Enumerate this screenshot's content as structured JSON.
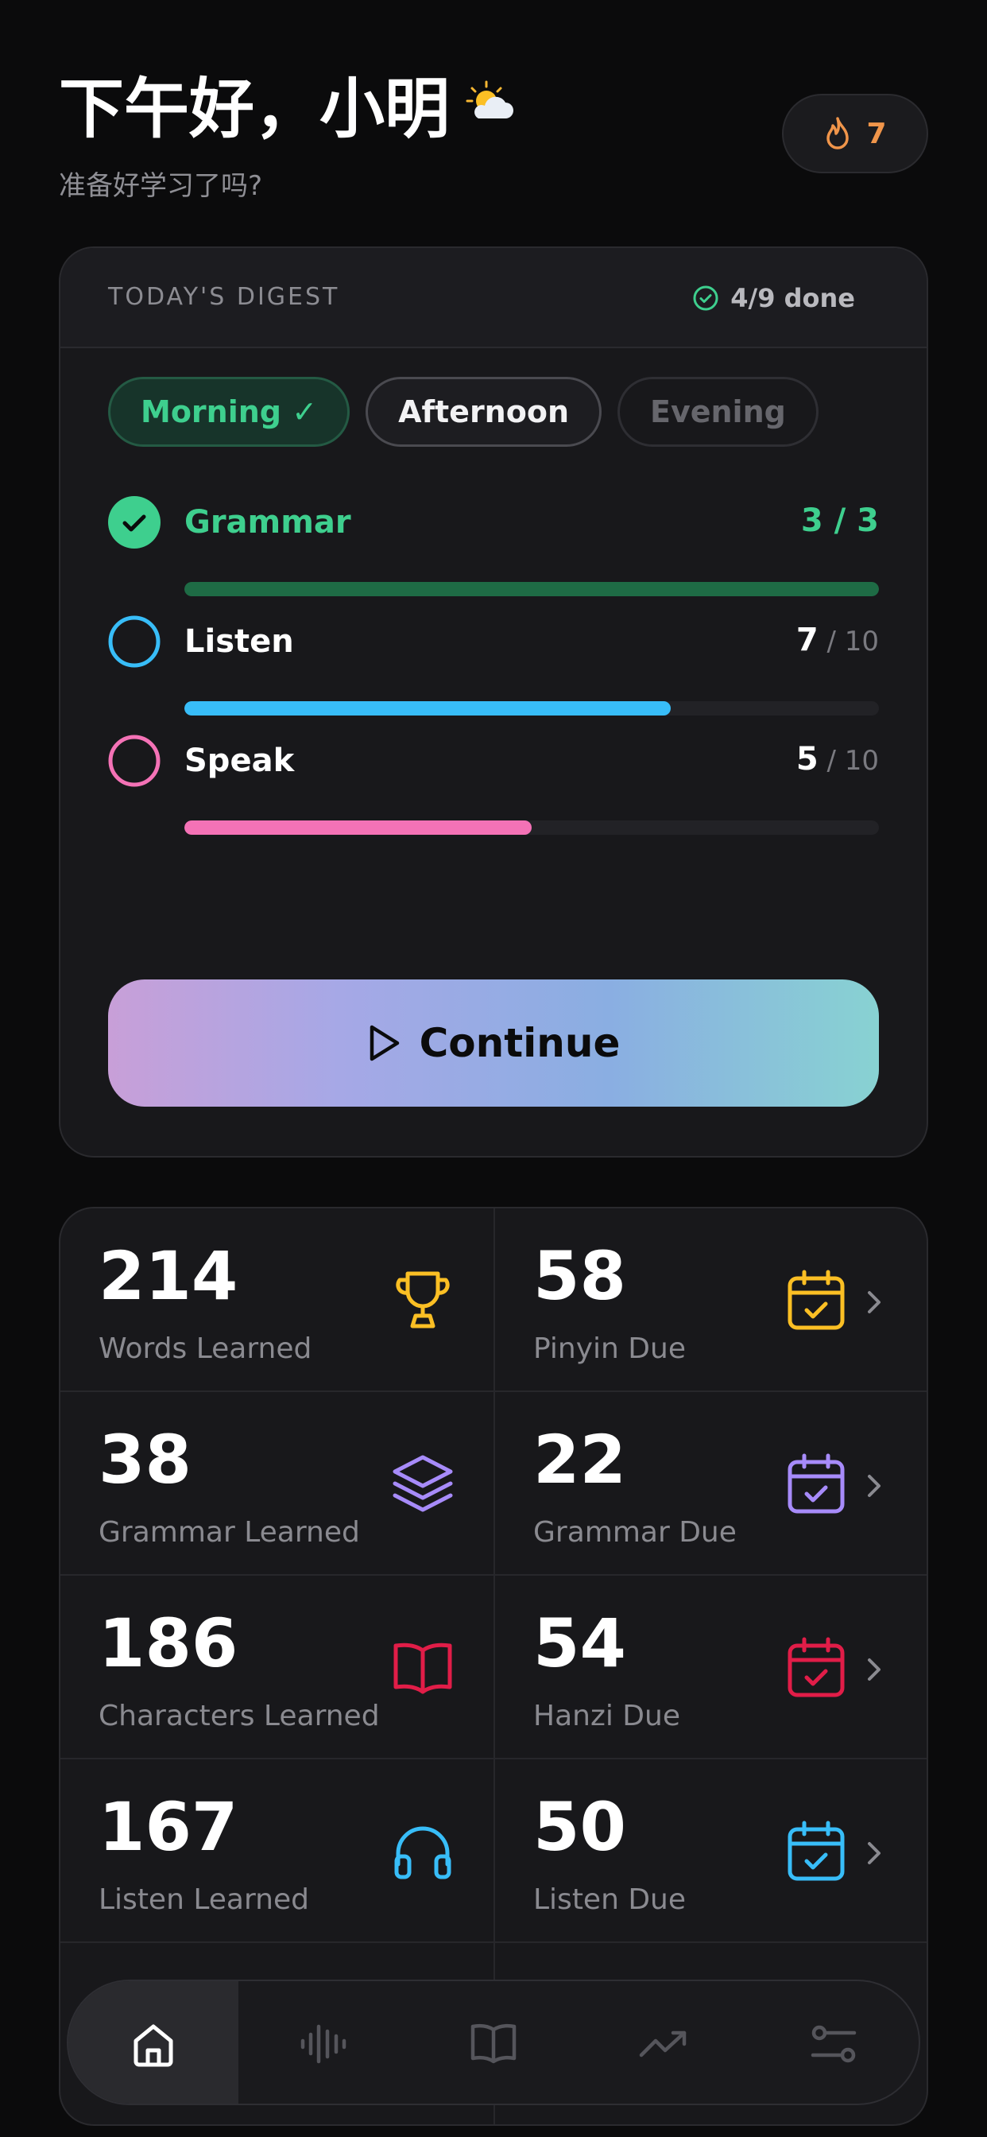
{
  "header": {
    "greeting": "下午好，小明",
    "weather_icon": "sun-behind-cloud-icon",
    "subtitle": "准备好学习了吗?",
    "streak": {
      "icon": "flame-icon",
      "count": "7",
      "color": "#f0954a"
    }
  },
  "digest": {
    "label": "TODAY'S DIGEST",
    "done_text": "4/9 done",
    "tabs": [
      {
        "label": "Morning ✓",
        "state": "completed"
      },
      {
        "label": "Afternoon",
        "state": "selected"
      },
      {
        "label": "Evening",
        "state": "upcoming"
      }
    ],
    "tasks": [
      {
        "name": "Grammar",
        "done": "3 / 3",
        "current": "",
        "total": "",
        "progress": 1.0,
        "completed": true,
        "color": "#3ecf8e",
        "bar_color": "#1e6b45"
      },
      {
        "name": "Listen",
        "done": "",
        "current": "7",
        "total": " / 10",
        "progress": 0.7,
        "completed": false,
        "color": "#38bdf8",
        "bar_color": "#38bdf8"
      },
      {
        "name": "Speak",
        "done": "",
        "current": "5",
        "total": " / 10",
        "progress": 0.5,
        "completed": false,
        "color": "#f472b6",
        "bar_color": "#f472b6"
      }
    ],
    "continue_label": "Continue"
  },
  "stats": [
    {
      "value": "214",
      "label": "Words Learned",
      "icon": "trophy-icon",
      "color": "#fbbf24"
    },
    {
      "value": "58",
      "label": "Pinyin Due",
      "icon": "calendar-check-icon",
      "color": "#fbbf24"
    },
    {
      "value": "38",
      "label": "Grammar Learned",
      "icon": "layers-icon",
      "color": "#a78bfa"
    },
    {
      "value": "22",
      "label": "Grammar Due",
      "icon": "calendar-check-icon",
      "color": "#a78bfa"
    },
    {
      "value": "186",
      "label": "Characters Learned",
      "icon": "open-book-icon",
      "color": "#e11d48"
    },
    {
      "value": "54",
      "label": "Hanzi Due",
      "icon": "calendar-check-icon",
      "color": "#e11d48"
    },
    {
      "value": "167",
      "label": "Listen Learned",
      "icon": "headphones-icon",
      "color": "#38bdf8"
    },
    {
      "value": "50",
      "label": "Listen Due",
      "icon": "calendar-check-icon",
      "color": "#38bdf8"
    }
  ],
  "nav": [
    {
      "icon": "home-icon",
      "active": true
    },
    {
      "icon": "waveform-icon",
      "active": false
    },
    {
      "icon": "book-icon",
      "active": false
    },
    {
      "icon": "trending-up-icon",
      "active": false
    },
    {
      "icon": "sliders-icon",
      "active": false
    }
  ]
}
